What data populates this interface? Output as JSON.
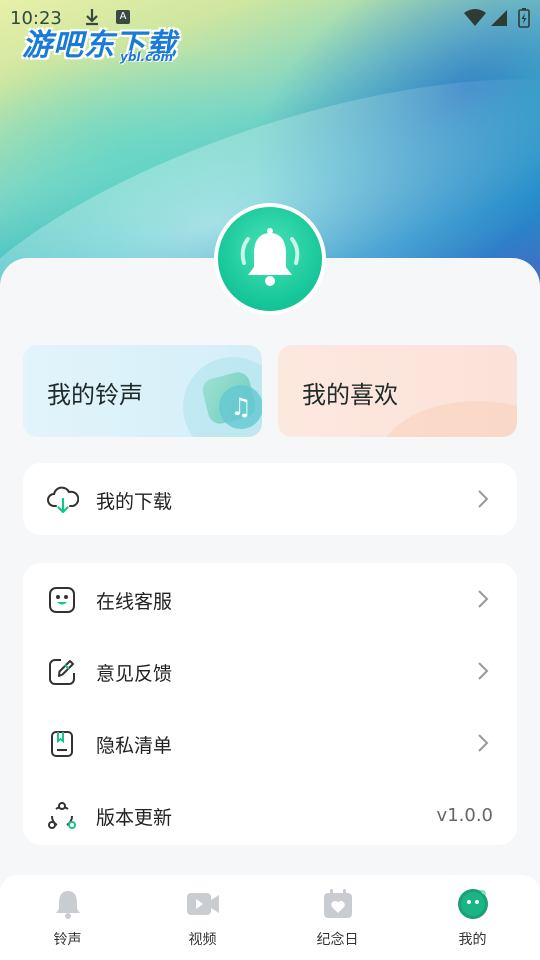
{
  "status_bar": {
    "time": "10:23",
    "a_badge": "A"
  },
  "watermark": {
    "text": "游吧东下载",
    "sub": "ybl.com"
  },
  "cards": {
    "ringtones_label": "我的铃声",
    "favorites_label": "我的喜欢"
  },
  "downloads": {
    "label": "我的下载"
  },
  "menu": {
    "items": [
      {
        "label": "在线客服",
        "icon": "support-face-icon"
      },
      {
        "label": "意见反馈",
        "icon": "edit-feedback-icon"
      },
      {
        "label": "隐私清单",
        "icon": "privacy-list-icon"
      },
      {
        "label": "版本更新",
        "icon": "version-update-icon"
      }
    ],
    "version": "v1.0.0"
  },
  "tabbar": {
    "tabs": [
      {
        "label": "铃声",
        "icon": "bell-icon"
      },
      {
        "label": "视频",
        "icon": "video-icon"
      },
      {
        "label": "纪念日",
        "icon": "calendar-heart-icon"
      },
      {
        "label": "我的",
        "icon": "profile-icon"
      }
    ],
    "active_index": 3
  },
  "colors": {
    "accent": "#17c79a",
    "inactive_icon": "#c9ccd1"
  }
}
